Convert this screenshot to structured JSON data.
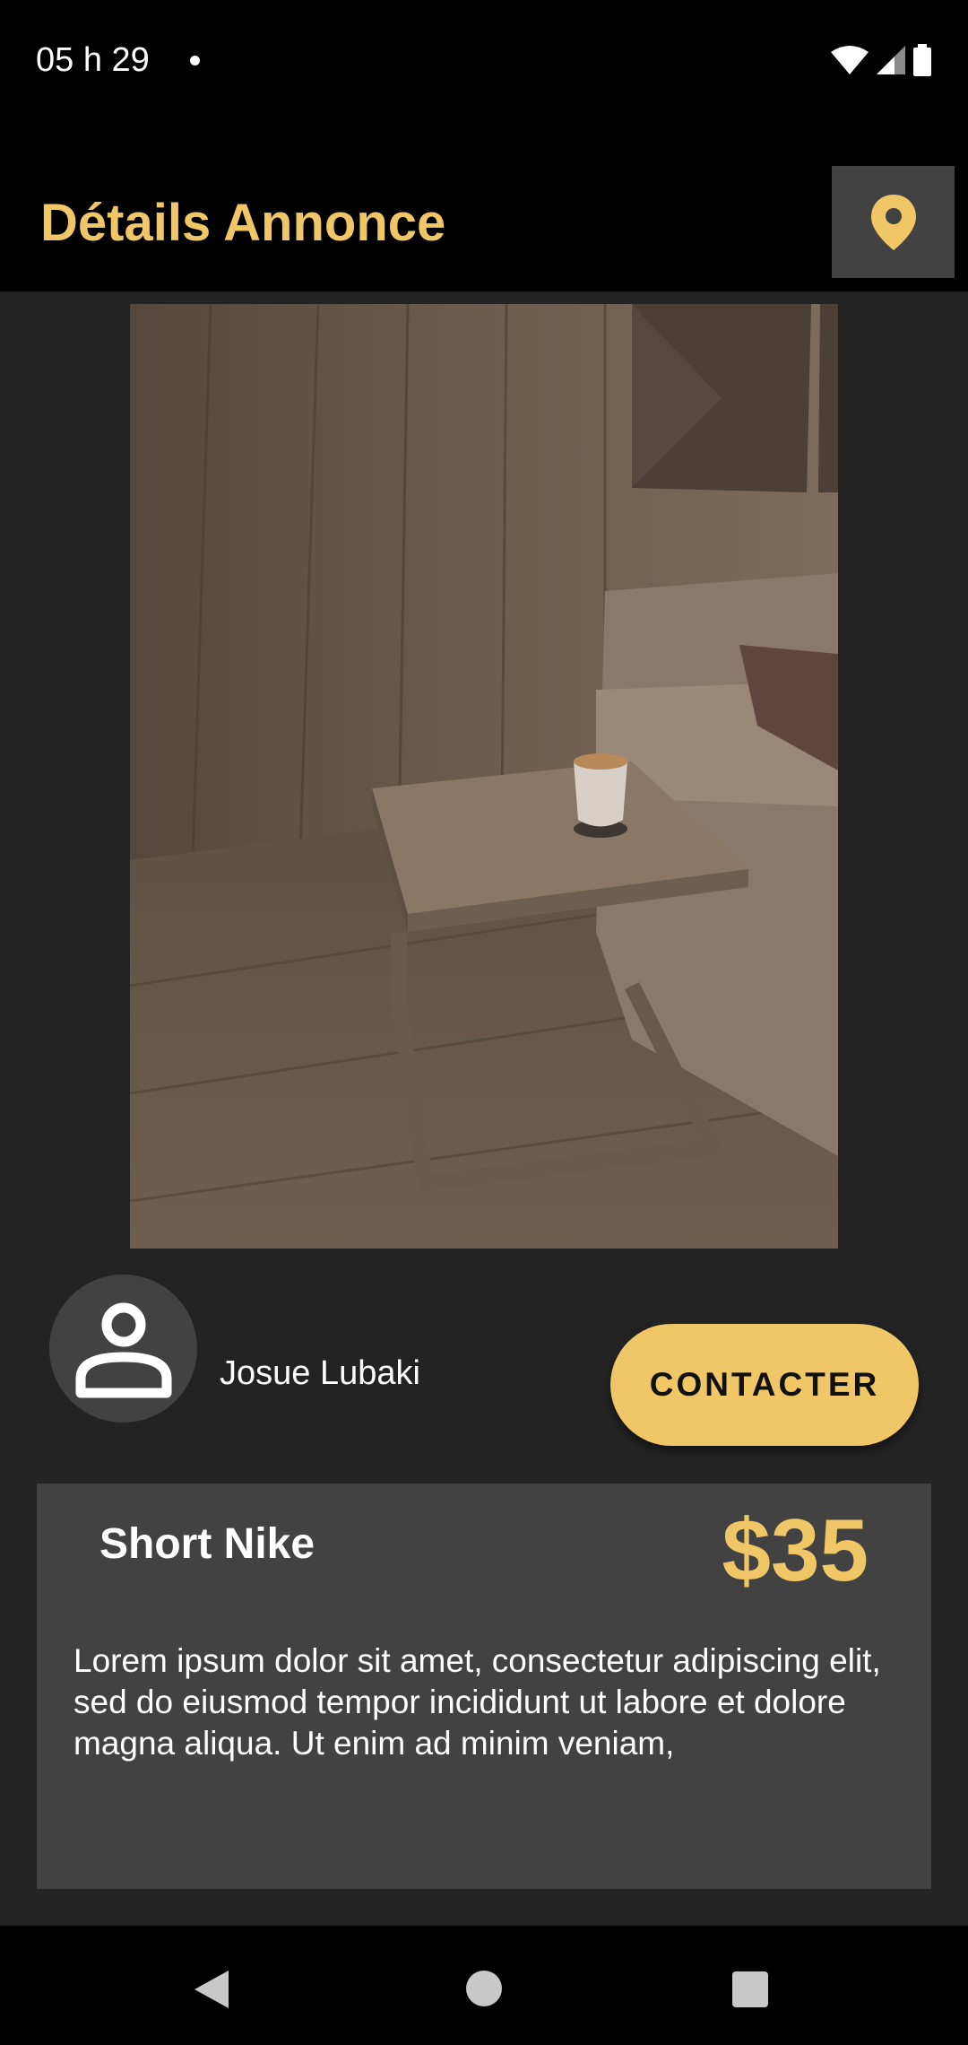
{
  "status_bar": {
    "time": "05 h 29",
    "icons": [
      "wifi-icon",
      "cell-signal-icon",
      "battery-icon"
    ]
  },
  "app_bar": {
    "title": "Détails Annonce",
    "action_icon": "location-pin-icon"
  },
  "product": {
    "image_description": "side-table-with-coffee-cup"
  },
  "seller": {
    "avatar_icon": "person-icon",
    "name": "Josue Lubaki"
  },
  "contact_button": {
    "label": "CONTACTER"
  },
  "listing": {
    "title": "Short Nike",
    "price": "$35",
    "description": "Lorem ipsum dolor sit amet, consectetur adipiscing elit, sed do eiusmod tempor incididunt ut labore et dolore magna aliqua. Ut enim ad minim veniam,"
  },
  "nav_bar": {
    "icons": [
      "back-icon",
      "home-icon",
      "recents-icon"
    ]
  },
  "colors": {
    "accent": "#f0c766",
    "background": "#232323",
    "card": "#424242",
    "bar": "#000000"
  }
}
